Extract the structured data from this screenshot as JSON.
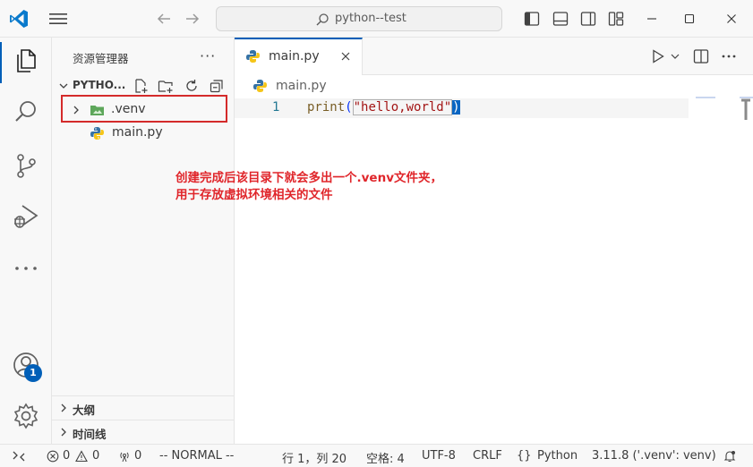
{
  "window": {
    "search_text": "python--test"
  },
  "sidebar": {
    "title": "资源管理器",
    "more": "···",
    "folder_name": "PYTHO...",
    "tree": [
      {
        "label": ".venv",
        "kind": "folder"
      },
      {
        "label": "main.py",
        "kind": "python"
      }
    ],
    "outline_label": "大纲",
    "timeline_label": "时间线"
  },
  "activitybar": {
    "account_badge": "1"
  },
  "editor": {
    "tab_label": "main.py",
    "breadcrumb": "main.py",
    "line_number": "1",
    "code": {
      "fn": "print",
      "open_paren": "(",
      "string": "\"hello,world\"",
      "close_paren": ")"
    },
    "more": "···"
  },
  "annotation": {
    "line1": "创建完成后该目录下就会多出一个.venv文件夹，",
    "line2": "用于存放虚拟环境相关的文件"
  },
  "statusbar": {
    "errors": "0",
    "warnings": "0",
    "ports": "0",
    "mode": "-- NORMAL --",
    "position": "行 1，列 20",
    "spaces": "空格: 4",
    "encoding": "UTF-8",
    "eol": "CRLF",
    "braces": "{}",
    "language": "Python",
    "interpreter": "3.11.8 ('.venv': venv)"
  },
  "colors": {
    "accent": "#005fb8",
    "annotation": "#e0262b",
    "highlight_box": "#d42a2a"
  }
}
